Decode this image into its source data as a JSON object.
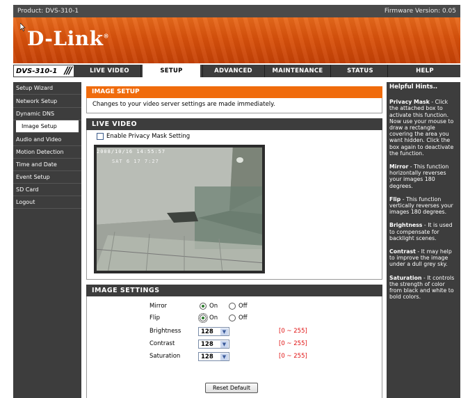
{
  "topbar": {
    "product": "Product: DVS-310-1",
    "firmware": "Firmware Version: 0.05"
  },
  "brand": {
    "logo": "D-Link",
    "reg_mark": "®"
  },
  "nav": {
    "model": "DVS-310-1",
    "tabs": [
      "LIVE VIDEO",
      "SETUP",
      "ADVANCED",
      "MAINTENANCE",
      "STATUS",
      "HELP"
    ],
    "active_tab": "SETUP"
  },
  "sidebar": {
    "items": [
      "Setup Wizard",
      "Network Setup",
      "Dynamic DNS",
      "Image Setup",
      "Audio and Video",
      "Motion Detection",
      "Time and Date",
      "Event Setup",
      "SD Card",
      "Logout"
    ],
    "active_item": "Image Setup"
  },
  "image_setup": {
    "title": "IMAGE SETUP",
    "description": "Changes to your video server settings are made immediately."
  },
  "live_video": {
    "title": "LIVE VIDEO",
    "privacy_mask_label": "Enable Privacy Mask Setting",
    "privacy_mask_checked": false,
    "overlay_line1": "2008/10/16 14:55:57",
    "overlay_line2": "SAT 6 17 7:27"
  },
  "image_settings": {
    "title": "IMAGE SETTINGS",
    "mirror": {
      "label": "Mirror",
      "on": "On",
      "off": "Off",
      "value": "On"
    },
    "flip": {
      "label": "Flip",
      "on": "On",
      "off": "Off",
      "value": "On"
    },
    "brightness": {
      "label": "Brightness",
      "value": "128",
      "range": "[0 ~ 255]"
    },
    "contrast": {
      "label": "Contrast",
      "value": "128",
      "range": "[0 ~ 255]"
    },
    "saturation": {
      "label": "Saturation",
      "value": "128",
      "range": "[0 ~ 255]"
    },
    "reset_label": "Reset Default"
  },
  "hints": {
    "title": "Helpful Hints..",
    "privacy_title": "Privacy Mask",
    "privacy_text": " - Click the attached box to activate this function. Now use your mouse to draw a rectangle covering the area you want hidden. Click the box again to deactivate the function.",
    "mirror_title": "Mirror",
    "mirror_text": " - This function horizontally reverses your images 180 degrees.",
    "flip_title": "Flip",
    "flip_text": " - This function vertically reverses your images 180 degrees.",
    "brightness_title": "Brightness",
    "brightness_text": " - It is used to compensate for backlight scenes.",
    "contrast_title": "Contrast",
    "contrast_text": " - It may help to improve the image under a dull grey sky.",
    "saturation_title": "Saturation",
    "saturation_text": " - It controls the strength of color from black and white to bold colors."
  },
  "colors": {
    "orange": "#f06b0c",
    "dark": "#3d3d3d",
    "range_red": "#e01010"
  }
}
